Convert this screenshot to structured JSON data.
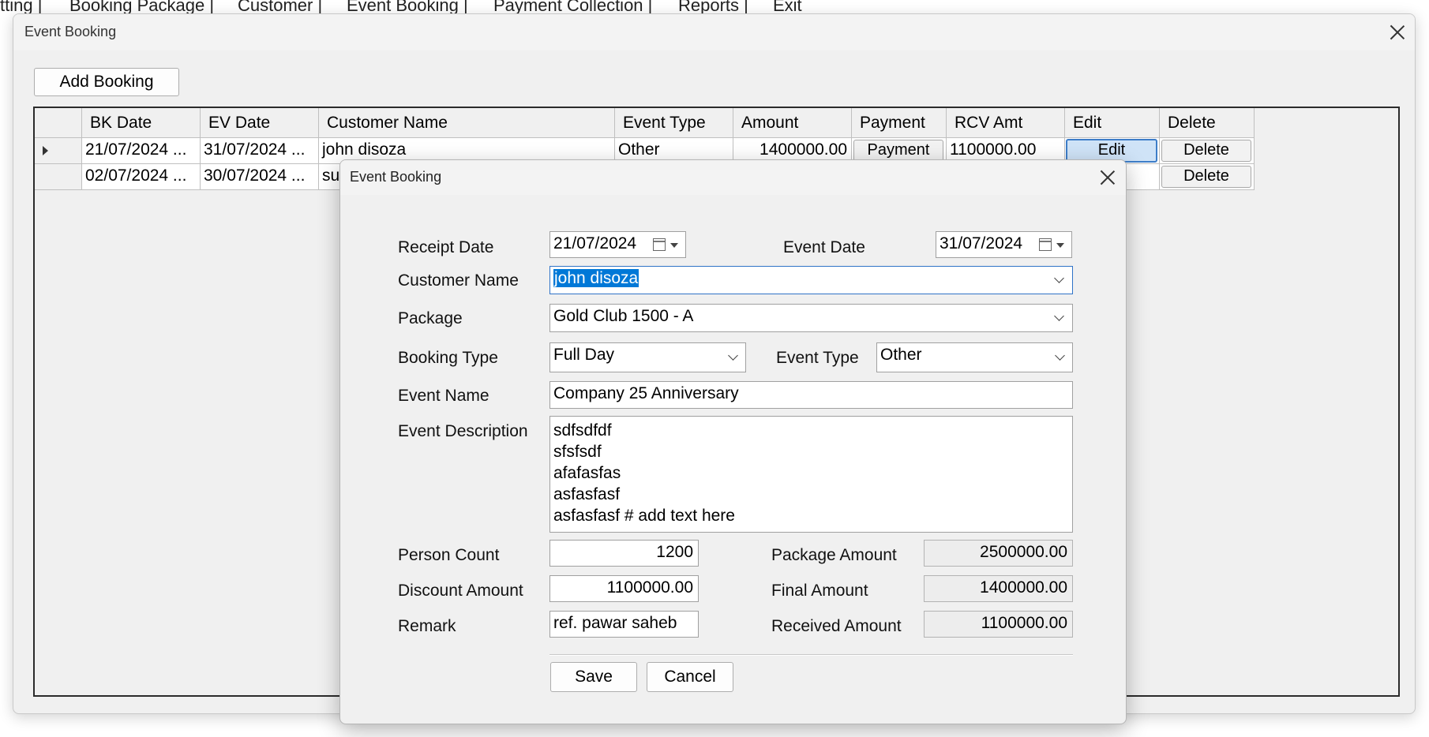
{
  "menu": [
    "tting |",
    "Booking Package |",
    "Customer |",
    "Event Booking |",
    "Payment Collection |",
    "Reports |",
    "Exit"
  ],
  "main_window": {
    "title": "Event Booking",
    "add_button": "Add Booking"
  },
  "grid": {
    "columns": [
      "BK Date",
      "EV Date",
      "Customer Name",
      "Event Type",
      "Amount",
      "Payment",
      "RCV Amt",
      "Edit",
      "Delete"
    ],
    "rows": [
      {
        "bk": "21/07/2024 ...",
        "ev": "31/07/2024 ...",
        "customer": "john disoza",
        "event_type": "Other",
        "amount": "1400000.00",
        "payment": "Payment",
        "rcv": "1100000.00",
        "edit": "Edit",
        "delete": "Delete"
      },
      {
        "bk": "02/07/2024 ...",
        "ev": "30/07/2024 ...",
        "customer": "su",
        "delete": "Delete"
      }
    ]
  },
  "dialog": {
    "title": "Event Booking",
    "labels": {
      "receipt_date": "Receipt Date",
      "event_date": "Event Date",
      "customer_name": "Customer Name",
      "package": "Package",
      "booking_type": "Booking Type",
      "event_type": "Event Type",
      "event_name": "Event Name",
      "event_description": "Event Description",
      "person_count": "Person Count",
      "package_amount": "Package Amount",
      "discount_amount": "Discount Amount",
      "final_amount": "Final Amount",
      "remark": "Remark",
      "received_amount": "Received Amount"
    },
    "values": {
      "receipt_date": "21/07/2024",
      "event_date": "31/07/2024",
      "customer_name": "john disoza",
      "package": "Gold Club 1500 - A",
      "booking_type": "Full Day",
      "event_type": "Other",
      "event_name": "Company 25 Anniversary",
      "event_description": "sdfsdfdf\nsfsfsdf\nafafasfas\nasfasfasf\nasfasfasf # add text here",
      "person_count": "1200",
      "package_amount": "2500000.00",
      "discount_amount": "1100000.00",
      "final_amount": "1400000.00",
      "remark": "ref. pawar saheb",
      "received_amount": "1100000.00"
    },
    "buttons": {
      "save": "Save",
      "cancel": "Cancel"
    }
  }
}
